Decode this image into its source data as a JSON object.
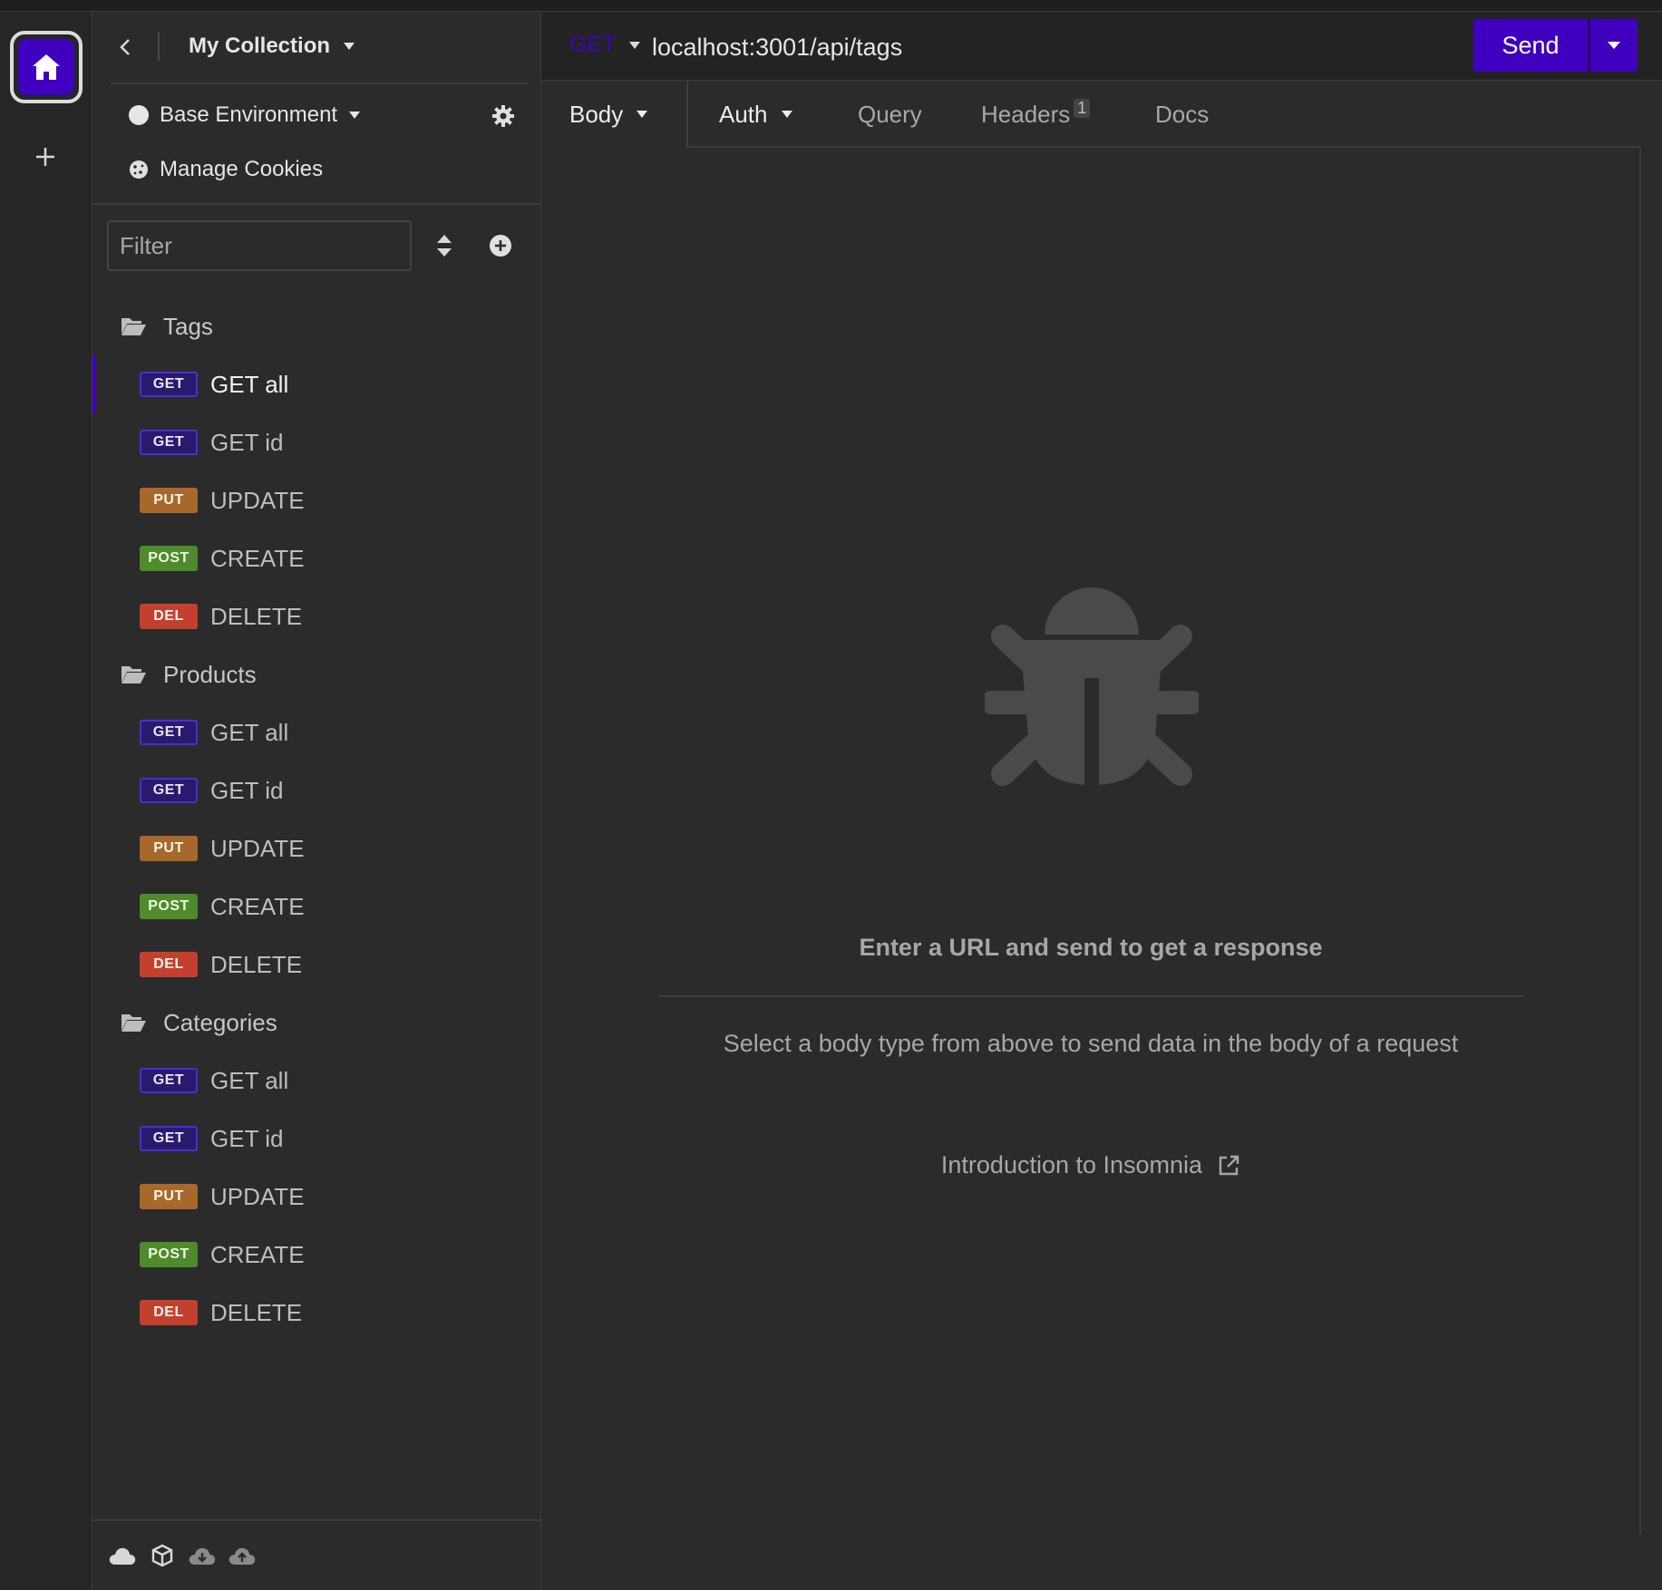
{
  "collection": {
    "title": "My Collection"
  },
  "environment": {
    "name": "Base Environment",
    "cookies_label": "Manage Cookies"
  },
  "filter": {
    "placeholder": "Filter"
  },
  "tree": [
    {
      "folder": "Tags",
      "requests": [
        {
          "method": "GET",
          "name": "GET all",
          "active": true
        },
        {
          "method": "GET",
          "name": "GET id"
        },
        {
          "method": "PUT",
          "name": "UPDATE"
        },
        {
          "method": "POST",
          "name": "CREATE"
        },
        {
          "method": "DEL",
          "name": "DELETE"
        }
      ]
    },
    {
      "folder": "Products",
      "requests": [
        {
          "method": "GET",
          "name": "GET all"
        },
        {
          "method": "GET",
          "name": "GET id"
        },
        {
          "method": "PUT",
          "name": "UPDATE"
        },
        {
          "method": "POST",
          "name": "CREATE"
        },
        {
          "method": "DEL",
          "name": "DELETE"
        }
      ]
    },
    {
      "folder": "Categories",
      "requests": [
        {
          "method": "GET",
          "name": "GET all"
        },
        {
          "method": "GET",
          "name": "GET id"
        },
        {
          "method": "PUT",
          "name": "UPDATE"
        },
        {
          "method": "POST",
          "name": "CREATE"
        },
        {
          "method": "DEL",
          "name": "DELETE"
        }
      ]
    }
  ],
  "request": {
    "method": "GET",
    "url": "localhost:3001/api/tags",
    "send_label": "Send"
  },
  "tabs": {
    "body": "Body",
    "auth": "Auth",
    "query": "Query",
    "headers": "Headers",
    "headers_count": "1",
    "docs": "Docs"
  },
  "empty_state": {
    "title": "Enter a URL and send to get a response",
    "subtitle": "Select a body type from above to send data in the body of a request",
    "link": "Introduction to Insomnia"
  },
  "colors": {
    "accent": "#4000bf",
    "get": "#4b2fcf",
    "put": "#a8682b",
    "post": "#4f8a2c",
    "del": "#c2402d"
  }
}
